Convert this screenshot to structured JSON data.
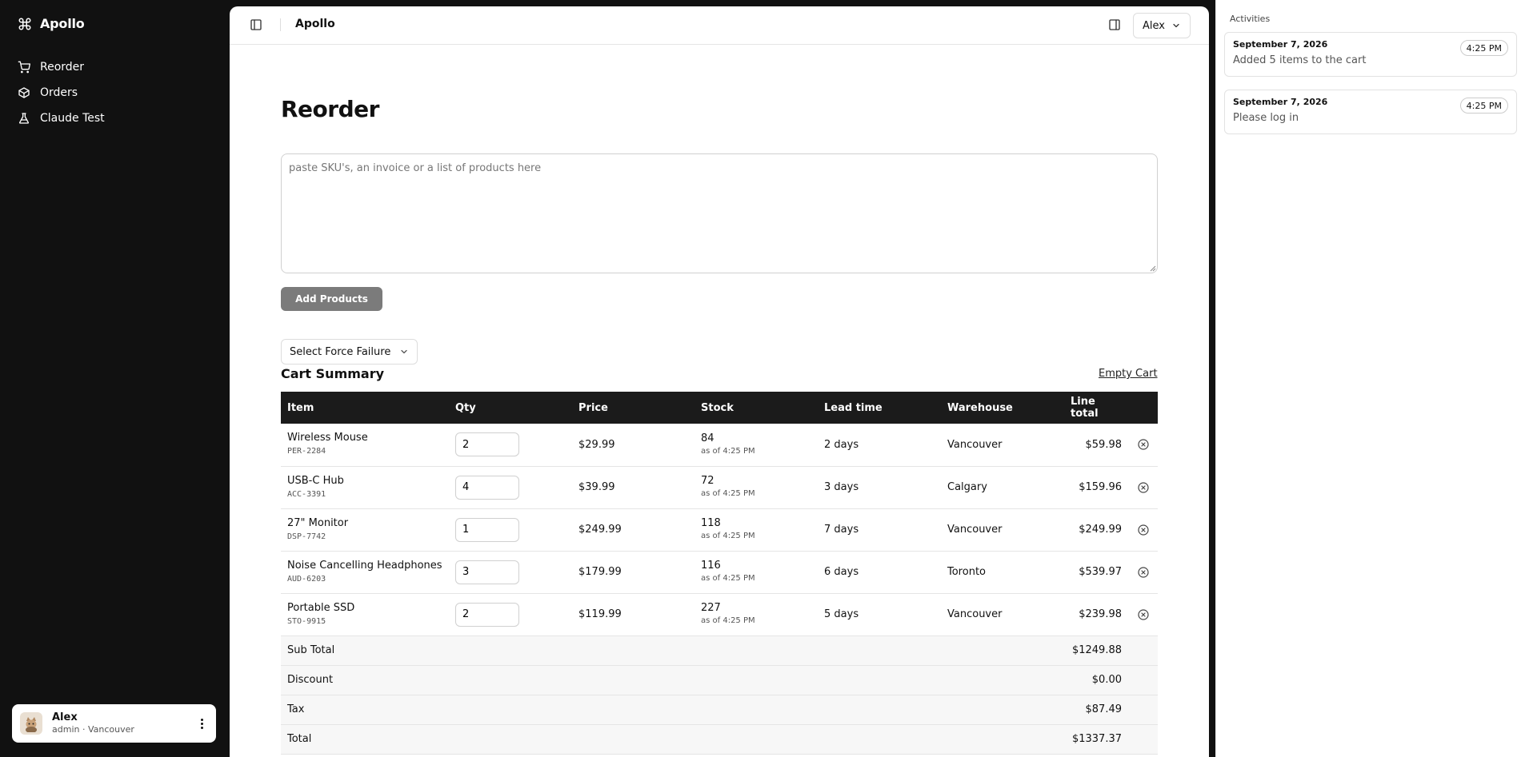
{
  "sidebar": {
    "brand": "Apollo",
    "items": [
      {
        "label": "Reorder",
        "icon": "cart-icon"
      },
      {
        "label": "Orders",
        "icon": "box-icon"
      },
      {
        "label": "Claude Test",
        "icon": "flask-icon"
      }
    ],
    "user": {
      "name": "Alex",
      "role": "admin · Vancouver"
    }
  },
  "topbar": {
    "title": "Apollo",
    "user_menu": "Alex"
  },
  "main": {
    "title": "Reorder",
    "paste_placeholder": "paste SKU's, an invoice or a list of products here",
    "add_button": "Add Products",
    "force_failure": "Select Force Failure",
    "cart_title": "Cart Summary",
    "empty_cart": "Empty Cart"
  },
  "cart": {
    "headers": [
      "Item",
      "Qty",
      "Price",
      "Stock",
      "Lead time",
      "Warehouse",
      "Line total"
    ],
    "rows": [
      {
        "name": "Wireless Mouse",
        "sku": "PER-2284",
        "qty": "2",
        "price": "$29.99",
        "stock": "84",
        "stock_as": "as of 4:25 PM",
        "lead": "2 days",
        "warehouse": "Vancouver",
        "total": "$59.98"
      },
      {
        "name": "USB-C Hub",
        "sku": "ACC-3391",
        "qty": "4",
        "price": "$39.99",
        "stock": "72",
        "stock_as": "as of 4:25 PM",
        "lead": "3 days",
        "warehouse": "Calgary",
        "total": "$159.96"
      },
      {
        "name": "27\" Monitor",
        "sku": "DSP-7742",
        "qty": "1",
        "price": "$249.99",
        "stock": "118",
        "stock_as": "as of 4:25 PM",
        "lead": "7 days",
        "warehouse": "Vancouver",
        "total": "$249.99"
      },
      {
        "name": "Noise Cancelling Headphones",
        "sku": "AUD-6203",
        "qty": "3",
        "price": "$179.99",
        "stock": "116",
        "stock_as": "as of 4:25 PM",
        "lead": "6 days",
        "warehouse": "Toronto",
        "total": "$539.97"
      },
      {
        "name": "Portable SSD",
        "sku": "STO-9915",
        "qty": "2",
        "price": "$119.99",
        "stock": "227",
        "stock_as": "as of 4:25 PM",
        "lead": "5 days",
        "warehouse": "Vancouver",
        "total": "$239.98"
      }
    ],
    "summary": [
      {
        "label": "Sub Total",
        "value": "$1249.88"
      },
      {
        "label": "Discount",
        "value": "$0.00"
      },
      {
        "label": "Tax",
        "value": "$87.49"
      },
      {
        "label": "Total",
        "value": "$1337.37"
      }
    ]
  },
  "activities": {
    "heading": "Activities",
    "items": [
      {
        "date": "September 7, 2026",
        "time": "4:25 PM",
        "text": "Added 5 items to the cart"
      },
      {
        "date": "September 7, 2026",
        "time": "4:25 PM",
        "text": "Please log in"
      }
    ]
  }
}
